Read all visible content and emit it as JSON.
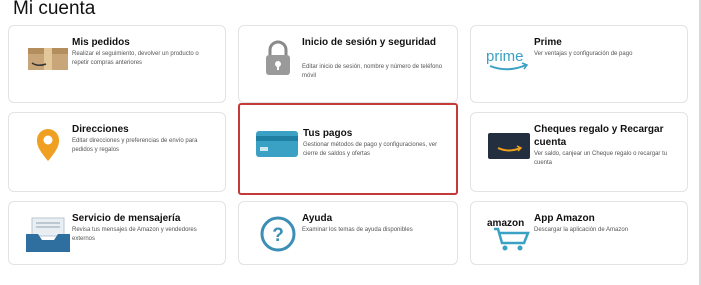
{
  "page": {
    "title": "Mi cuenta"
  },
  "cards": {
    "orders": {
      "title": "Mis pedidos",
      "desc": "Realizar el seguimiento, devolver un producto o repetir compras anteriores",
      "icon": "package-icon"
    },
    "login": {
      "title": "Inicio de sesión y seguridad",
      "desc": "Editar inicio de sesión, nombre y número de teléfono móvil",
      "icon": "padlock-icon"
    },
    "prime": {
      "title": "Prime",
      "desc": "Ver ventajas y configuración de pago",
      "icon": "prime-logo-icon"
    },
    "addresses": {
      "title": "Direcciones",
      "desc": "Editar direcciones y preferencias de envío para pedidos y regalos",
      "icon": "location-pin-icon"
    },
    "payments": {
      "title": "Tus pagos",
      "desc": "Gestionar métodos de pago y configuraciones, ver cierre de saldos y ofertas",
      "icon": "credit-card-icon"
    },
    "giftcards": {
      "title": "Cheques regalo y Recargar cuenta",
      "desc": "Ver saldo, canjear un Cheque regalo o recargar tu cuenta",
      "icon": "gift-card-icon"
    },
    "messages": {
      "title": "Servicio de mensajería",
      "desc": "Revisa tus mensajes de Amazon y vendedores externos",
      "icon": "inbox-icon"
    },
    "help": {
      "title": "Ayuda",
      "desc": "Examinar los temas de ayuda disponibles",
      "icon": "help-icon"
    },
    "app": {
      "title": "App Amazon",
      "desc": "Descargar la aplicación de Amazon",
      "icon": "amazon-cart-icon"
    }
  },
  "colors": {
    "highlight_border": "#c4393a",
    "accent_blue": "#3ba1c4",
    "pin_orange": "#f0a020"
  }
}
